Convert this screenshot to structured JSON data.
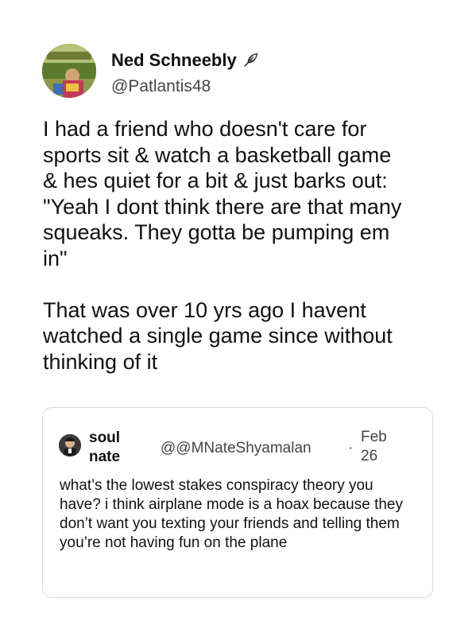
{
  "author": {
    "name": "Ned Schneebly",
    "handle": "@Patlantis48",
    "avatar_icon": "avatar-photo",
    "badge_icon": "feather-icon"
  },
  "tweet": {
    "text": "I had a friend who doesn't care for\nsports sit & watch a basketball game\n& hes quiet for a bit & just barks out:\n\"Yeah I dont think there are that many\nsqueaks. They gotta be pumping em\nin\"\n\nThat was over 10 yrs ago I havent\nwatched a single game since without\nthinking of it"
  },
  "quote": {
    "name": "soul nate",
    "handle": "@@MNateShyamalan",
    "separator": "·",
    "date": "Feb 26",
    "text": "what’s the lowest stakes conspiracy theory you have? i think airplane mode is a hoax because they don’t want you texting your friends and telling them you’re not having fun on the plane"
  }
}
